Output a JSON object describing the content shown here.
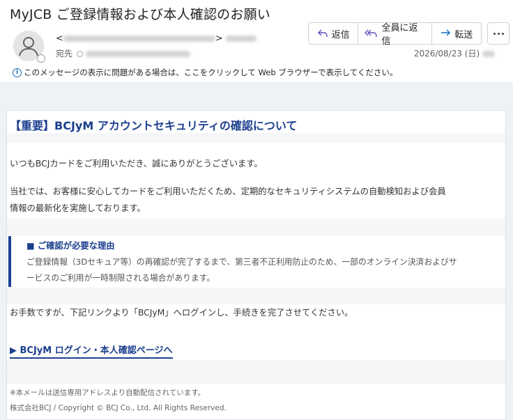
{
  "header": {
    "subject": "MyJCB ご登録情報および本人確認のお願い",
    "from_prefix": "<",
    "from_suffix": ">",
    "to_label": "宛先",
    "date": "2026/08/23 (日)",
    "actions": {
      "reply_label": "返信",
      "reply_all_label": "全員に返信",
      "forward_label": "転送"
    },
    "icons": {
      "avatar": "person-icon",
      "reply": "reply-icon",
      "reply_all": "reply-all-icon",
      "forward": "forward-icon",
      "more": "more-icon",
      "info": "info-icon"
    },
    "info_bar": "このメッセージの表示に問題がある場合は、ここをクリックして Web ブラウザーで表示してください。"
  },
  "email": {
    "title": "【重要】BCJyM アカウントセキュリティの確認について",
    "greeting": "いつもBCJカードをご利用いただき、誠にありがとうございます。",
    "intro_line1": "当社では、お客様に安心してカードをご利用いただくため、定期的なセキュリティシステムの自動検知および会員",
    "intro_line2": "情報の最新化を実施しております。",
    "notice": {
      "title": "■ ご確認が必要な理由",
      "line1": "ご登録情報（3Dセキュア等）の再確認が完了するまで、第三者不正利用防止のため、一部のオンライン決済およびサ",
      "line2": "ービスのご利用が一時制限される場合があります。"
    },
    "request": "お手数ですが、下記リンクより「BCJyM」へログインし、手続きを完了させてください。",
    "link_label": "▶ BCJyM ログイン・本人確認ページへ",
    "footer_note": "※本メールは送信専用アドレスより自動配信されています。",
    "copyright": "株式会社BCJ / Copyright © BCJ Co., Ltd. All Rights Reserved."
  },
  "colors": {
    "accent": "#1b3f8f",
    "outlook_blue": "#0f6cbd",
    "body_bg": "#eef1f5"
  }
}
